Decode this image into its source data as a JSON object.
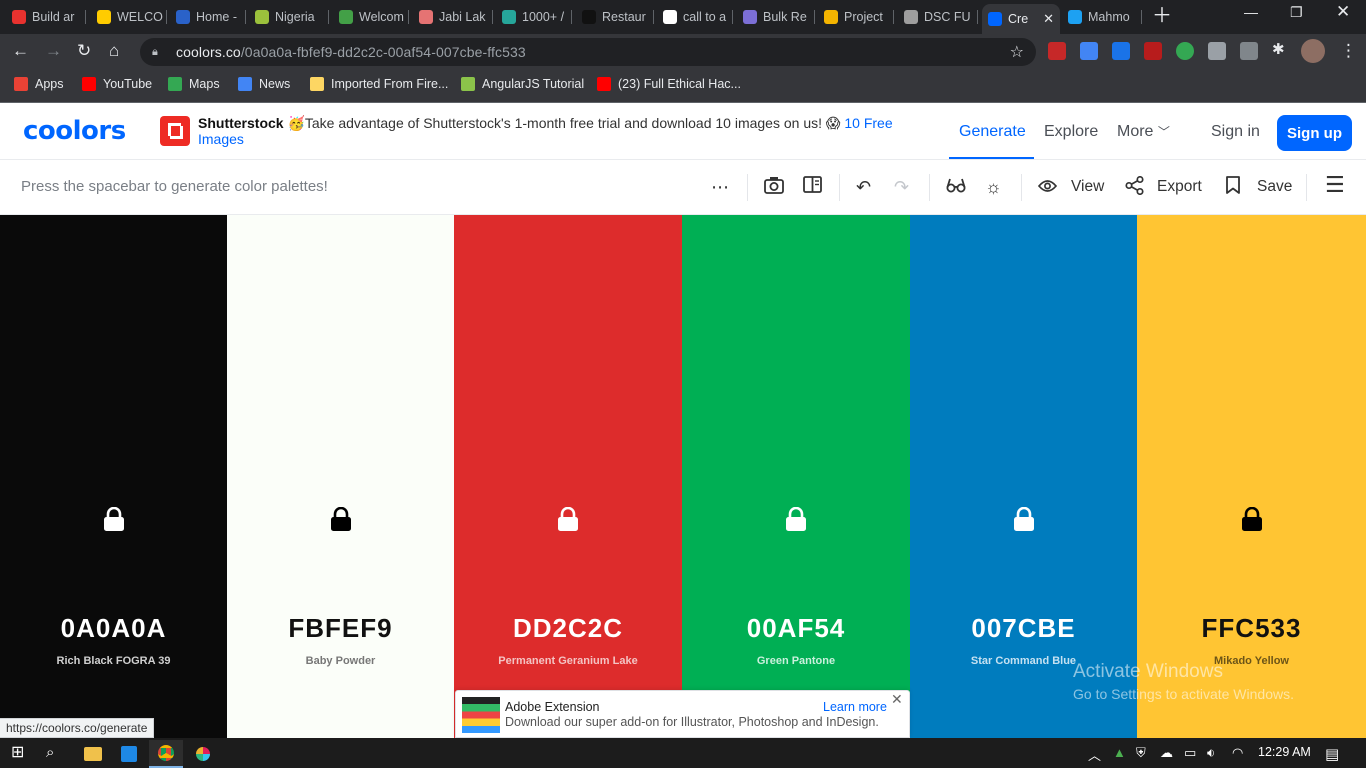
{
  "browser": {
    "tabs": [
      {
        "title": "Build ar",
        "color": "#e8322f"
      },
      {
        "title": "WELCO",
        "color": "#ffcc00"
      },
      {
        "title": "Home -",
        "color": "#2a62c9"
      },
      {
        "title": "Nigeria",
        "color": "#9bc13c"
      },
      {
        "title": "Welcom",
        "color": "#43a047"
      },
      {
        "title": "Jabi Lak",
        "color": "#e57373"
      },
      {
        "title": "1000+ /",
        "color": "#26a69a"
      },
      {
        "title": "Restaur",
        "color": "#111111"
      },
      {
        "title": "call to a",
        "color": "#ffffff"
      },
      {
        "title": "Bulk Re",
        "color": "#7c6fd6"
      },
      {
        "title": "Project",
        "color": "#f4b400"
      },
      {
        "title": "DSC FU",
        "color": "#9e9e9e"
      },
      {
        "title": "Cre",
        "color": "#0066ff"
      },
      {
        "title": "Mahmo",
        "color": "#1da1f2"
      }
    ],
    "url_host": "coolors.co",
    "url_path": "/0a0a0a-fbfef9-dd2c2c-00af54-007cbe-ffc533",
    "bookmarks": [
      {
        "label": "Apps",
        "color": "#e94235"
      },
      {
        "label": "YouTube",
        "color": "#ff0000"
      },
      {
        "label": "Maps",
        "color": "#34a853"
      },
      {
        "label": "News",
        "color": "#4285f4"
      },
      {
        "label": "Imported From Fire...",
        "color": "#fdd663"
      },
      {
        "label": "AngularJS Tutorial",
        "color": "#8bc34a"
      },
      {
        "label": "(23) Full Ethical Hac...",
        "color": "#ff0000"
      }
    ],
    "status_url": "https://coolors.co/generate"
  },
  "header": {
    "logo": "coolors",
    "ad_brand": "Shutterstock",
    "ad_text": "🥳Take advantage of Shutterstock's 1-month free trial and download 10 images on us! 😱",
    "ad_link": "10 Free Images",
    "nav": {
      "generate": "Generate",
      "explore": "Explore",
      "more": "More",
      "sign_in": "Sign in",
      "sign_up": "Sign up"
    }
  },
  "toolbar": {
    "hint": "Press the spacebar to generate color palettes!",
    "view_label": "View",
    "export_label": "Export",
    "save_label": "Save"
  },
  "palette": [
    {
      "hex": "0A0A0A",
      "name": "Rich Black FOGRA 39",
      "bg": "#0a0a0a",
      "fg": "#ffffff",
      "sub": "#cfcfcf",
      "lock": "#ffffff"
    },
    {
      "hex": "FBFEF9",
      "name": "Baby Powder",
      "bg": "#fbfef9",
      "fg": "#111111",
      "sub": "#777777",
      "lock": "#000000"
    },
    {
      "hex": "DD2C2C",
      "name": "Permanent Geranium Lake",
      "bg": "#dd2c2c",
      "fg": "#ffffff",
      "sub": "#f4c3c3",
      "lock": "#ffffff"
    },
    {
      "hex": "00AF54",
      "name": "Green Pantone",
      "bg": "#00af54",
      "fg": "#ffffff",
      "sub": "#c9f0dc",
      "lock": "#ffffff"
    },
    {
      "hex": "007CBE",
      "name": "Star Command Blue",
      "bg": "#007cbe",
      "fg": "#ffffff",
      "sub": "#c5e1f1",
      "lock": "#ffffff"
    },
    {
      "hex": "FFC533",
      "name": "Mikado Yellow",
      "bg": "#ffc533",
      "fg": "#111111",
      "sub": "#6d5517",
      "lock": "#000000"
    }
  ],
  "toast": {
    "title": "Adobe Extension",
    "learn_more": "Learn more",
    "description": "Download our super add-on for Illustrator, Photoshop and InDesign."
  },
  "watermark": {
    "line1": "Activate Windows",
    "line2": "Go to Settings to activate Windows."
  },
  "taskbar": {
    "time": "12:29 AM"
  }
}
